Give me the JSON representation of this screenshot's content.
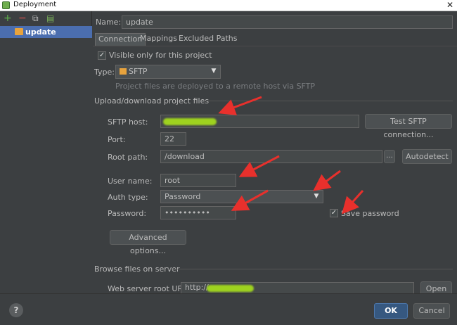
{
  "window": {
    "title": "Deployment",
    "close_glyph": "✕"
  },
  "left_toolbar": {
    "add": "+",
    "remove": "−",
    "copy": "⧉",
    "default": "▤"
  },
  "left_list": {
    "items": [
      {
        "label": "update"
      }
    ]
  },
  "name_row": {
    "label": "Name:",
    "value": "update"
  },
  "tabs": [
    {
      "label": "Connection"
    },
    {
      "label": "Mappings"
    },
    {
      "label": "Excluded Paths"
    }
  ],
  "visible_only": {
    "checked": true,
    "label": "Visible only for this project"
  },
  "type_row": {
    "label": "Type:",
    "value": "SFTP",
    "hint": "Project files are deployed to a remote host via SFTP"
  },
  "upload_section": {
    "title": "Upload/download project files",
    "sftp_host": {
      "label": "SFTP host:",
      "value": "",
      "button": "Test SFTP connection..."
    },
    "port": {
      "label": "Port:",
      "value": "22"
    },
    "root_path": {
      "label": "Root path:",
      "value": "/download",
      "browse": "...",
      "button": "Autodetect"
    },
    "user_name": {
      "label": "User name:",
      "value": "root"
    },
    "auth_type": {
      "label": "Auth type:",
      "value": "Password"
    },
    "password": {
      "label": "Password:",
      "value": "••••••••••"
    },
    "save_password": {
      "checked": true,
      "label": "Save password"
    },
    "advanced_button": "Advanced options..."
  },
  "browse_section": {
    "title": "Browse files on server",
    "web_root": {
      "label": "Web server root URL:",
      "value": "http://",
      "button": "Open"
    }
  },
  "bottom": {
    "help": "?",
    "ok": "OK",
    "cancel": "Cancel"
  },
  "colors": {
    "accent": "#4b6eaf",
    "annotation_arrow": "#e8302c",
    "redaction": "#9ed21f"
  }
}
